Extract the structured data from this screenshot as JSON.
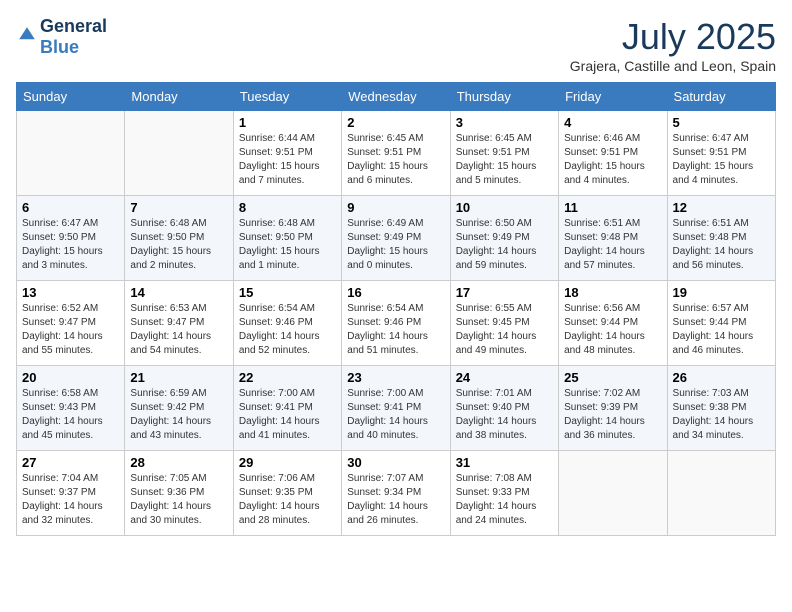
{
  "header": {
    "logo_line1": "General",
    "logo_line2": "Blue",
    "month_title": "July 2025",
    "location": "Grajera, Castille and Leon, Spain"
  },
  "days_of_week": [
    "Sunday",
    "Monday",
    "Tuesday",
    "Wednesday",
    "Thursday",
    "Friday",
    "Saturday"
  ],
  "weeks": [
    [
      {
        "num": "",
        "detail": ""
      },
      {
        "num": "",
        "detail": ""
      },
      {
        "num": "1",
        "detail": "Sunrise: 6:44 AM\nSunset: 9:51 PM\nDaylight: 15 hours\nand 7 minutes."
      },
      {
        "num": "2",
        "detail": "Sunrise: 6:45 AM\nSunset: 9:51 PM\nDaylight: 15 hours\nand 6 minutes."
      },
      {
        "num": "3",
        "detail": "Sunrise: 6:45 AM\nSunset: 9:51 PM\nDaylight: 15 hours\nand 5 minutes."
      },
      {
        "num": "4",
        "detail": "Sunrise: 6:46 AM\nSunset: 9:51 PM\nDaylight: 15 hours\nand 4 minutes."
      },
      {
        "num": "5",
        "detail": "Sunrise: 6:47 AM\nSunset: 9:51 PM\nDaylight: 15 hours\nand 4 minutes."
      }
    ],
    [
      {
        "num": "6",
        "detail": "Sunrise: 6:47 AM\nSunset: 9:50 PM\nDaylight: 15 hours\nand 3 minutes."
      },
      {
        "num": "7",
        "detail": "Sunrise: 6:48 AM\nSunset: 9:50 PM\nDaylight: 15 hours\nand 2 minutes."
      },
      {
        "num": "8",
        "detail": "Sunrise: 6:48 AM\nSunset: 9:50 PM\nDaylight: 15 hours\nand 1 minute."
      },
      {
        "num": "9",
        "detail": "Sunrise: 6:49 AM\nSunset: 9:49 PM\nDaylight: 15 hours\nand 0 minutes."
      },
      {
        "num": "10",
        "detail": "Sunrise: 6:50 AM\nSunset: 9:49 PM\nDaylight: 14 hours\nand 59 minutes."
      },
      {
        "num": "11",
        "detail": "Sunrise: 6:51 AM\nSunset: 9:48 PM\nDaylight: 14 hours\nand 57 minutes."
      },
      {
        "num": "12",
        "detail": "Sunrise: 6:51 AM\nSunset: 9:48 PM\nDaylight: 14 hours\nand 56 minutes."
      }
    ],
    [
      {
        "num": "13",
        "detail": "Sunrise: 6:52 AM\nSunset: 9:47 PM\nDaylight: 14 hours\nand 55 minutes."
      },
      {
        "num": "14",
        "detail": "Sunrise: 6:53 AM\nSunset: 9:47 PM\nDaylight: 14 hours\nand 54 minutes."
      },
      {
        "num": "15",
        "detail": "Sunrise: 6:54 AM\nSunset: 9:46 PM\nDaylight: 14 hours\nand 52 minutes."
      },
      {
        "num": "16",
        "detail": "Sunrise: 6:54 AM\nSunset: 9:46 PM\nDaylight: 14 hours\nand 51 minutes."
      },
      {
        "num": "17",
        "detail": "Sunrise: 6:55 AM\nSunset: 9:45 PM\nDaylight: 14 hours\nand 49 minutes."
      },
      {
        "num": "18",
        "detail": "Sunrise: 6:56 AM\nSunset: 9:44 PM\nDaylight: 14 hours\nand 48 minutes."
      },
      {
        "num": "19",
        "detail": "Sunrise: 6:57 AM\nSunset: 9:44 PM\nDaylight: 14 hours\nand 46 minutes."
      }
    ],
    [
      {
        "num": "20",
        "detail": "Sunrise: 6:58 AM\nSunset: 9:43 PM\nDaylight: 14 hours\nand 45 minutes."
      },
      {
        "num": "21",
        "detail": "Sunrise: 6:59 AM\nSunset: 9:42 PM\nDaylight: 14 hours\nand 43 minutes."
      },
      {
        "num": "22",
        "detail": "Sunrise: 7:00 AM\nSunset: 9:41 PM\nDaylight: 14 hours\nand 41 minutes."
      },
      {
        "num": "23",
        "detail": "Sunrise: 7:00 AM\nSunset: 9:41 PM\nDaylight: 14 hours\nand 40 minutes."
      },
      {
        "num": "24",
        "detail": "Sunrise: 7:01 AM\nSunset: 9:40 PM\nDaylight: 14 hours\nand 38 minutes."
      },
      {
        "num": "25",
        "detail": "Sunrise: 7:02 AM\nSunset: 9:39 PM\nDaylight: 14 hours\nand 36 minutes."
      },
      {
        "num": "26",
        "detail": "Sunrise: 7:03 AM\nSunset: 9:38 PM\nDaylight: 14 hours\nand 34 minutes."
      }
    ],
    [
      {
        "num": "27",
        "detail": "Sunrise: 7:04 AM\nSunset: 9:37 PM\nDaylight: 14 hours\nand 32 minutes."
      },
      {
        "num": "28",
        "detail": "Sunrise: 7:05 AM\nSunset: 9:36 PM\nDaylight: 14 hours\nand 30 minutes."
      },
      {
        "num": "29",
        "detail": "Sunrise: 7:06 AM\nSunset: 9:35 PM\nDaylight: 14 hours\nand 28 minutes."
      },
      {
        "num": "30",
        "detail": "Sunrise: 7:07 AM\nSunset: 9:34 PM\nDaylight: 14 hours\nand 26 minutes."
      },
      {
        "num": "31",
        "detail": "Sunrise: 7:08 AM\nSunset: 9:33 PM\nDaylight: 14 hours\nand 24 minutes."
      },
      {
        "num": "",
        "detail": ""
      },
      {
        "num": "",
        "detail": ""
      }
    ]
  ]
}
